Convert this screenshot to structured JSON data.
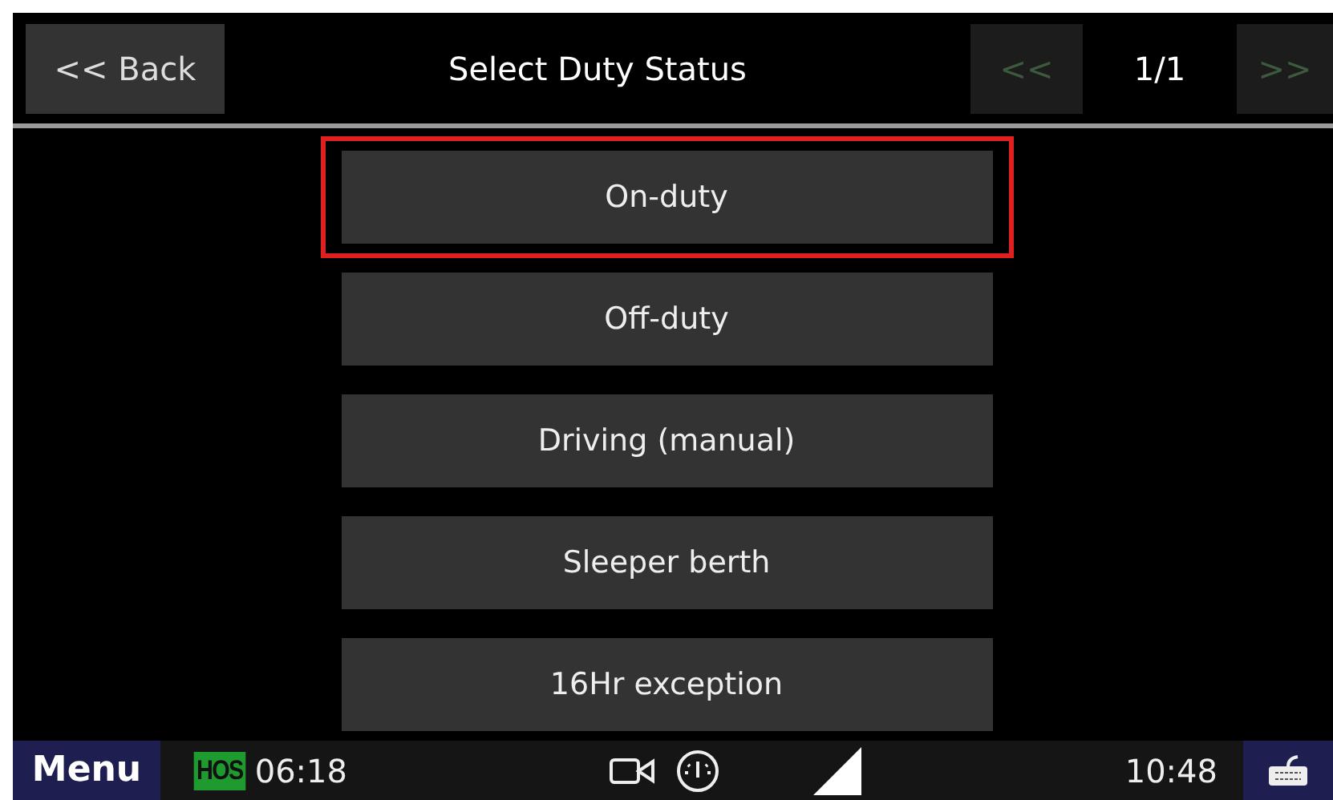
{
  "header": {
    "back": "<< Back",
    "title": "Select Duty Status",
    "prev": {
      "label": "<<",
      "disabled": true
    },
    "page": "1/1",
    "next": {
      "label": ">>",
      "disabled": true
    }
  },
  "options": [
    {
      "label": "On-duty",
      "highlighted": true
    },
    {
      "label": "Off-duty",
      "highlighted": false
    },
    {
      "label": "Driving (manual)",
      "highlighted": false
    },
    {
      "label": "Sleeper berth",
      "highlighted": false
    },
    {
      "label": "16Hr exception",
      "highlighted": false
    }
  ],
  "status_bar": {
    "menu": "Menu",
    "hos_badge": "HOS",
    "hos_time": "06:18",
    "clock": "10:48"
  }
}
